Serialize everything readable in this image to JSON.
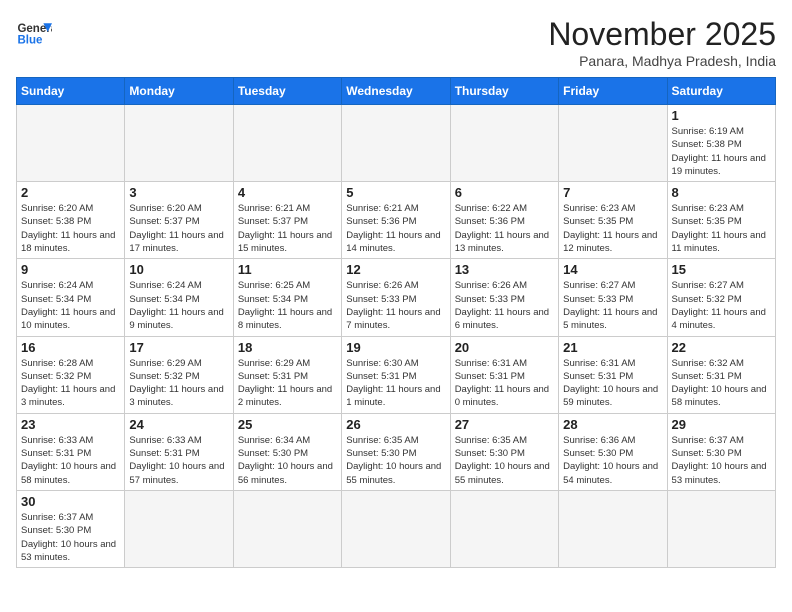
{
  "logo": {
    "text_general": "General",
    "text_blue": "Blue"
  },
  "title": "November 2025",
  "subtitle": "Panara, Madhya Pradesh, India",
  "days_of_week": [
    "Sunday",
    "Monday",
    "Tuesday",
    "Wednesday",
    "Thursday",
    "Friday",
    "Saturday"
  ],
  "weeks": [
    [
      {
        "day": "",
        "info": ""
      },
      {
        "day": "",
        "info": ""
      },
      {
        "day": "",
        "info": ""
      },
      {
        "day": "",
        "info": ""
      },
      {
        "day": "",
        "info": ""
      },
      {
        "day": "",
        "info": ""
      },
      {
        "day": "1",
        "info": "Sunrise: 6:19 AM\nSunset: 5:38 PM\nDaylight: 11 hours and 19 minutes."
      }
    ],
    [
      {
        "day": "2",
        "info": "Sunrise: 6:20 AM\nSunset: 5:38 PM\nDaylight: 11 hours and 18 minutes."
      },
      {
        "day": "3",
        "info": "Sunrise: 6:20 AM\nSunset: 5:37 PM\nDaylight: 11 hours and 17 minutes."
      },
      {
        "day": "4",
        "info": "Sunrise: 6:21 AM\nSunset: 5:37 PM\nDaylight: 11 hours and 15 minutes."
      },
      {
        "day": "5",
        "info": "Sunrise: 6:21 AM\nSunset: 5:36 PM\nDaylight: 11 hours and 14 minutes."
      },
      {
        "day": "6",
        "info": "Sunrise: 6:22 AM\nSunset: 5:36 PM\nDaylight: 11 hours and 13 minutes."
      },
      {
        "day": "7",
        "info": "Sunrise: 6:23 AM\nSunset: 5:35 PM\nDaylight: 11 hours and 12 minutes."
      },
      {
        "day": "8",
        "info": "Sunrise: 6:23 AM\nSunset: 5:35 PM\nDaylight: 11 hours and 11 minutes."
      }
    ],
    [
      {
        "day": "9",
        "info": "Sunrise: 6:24 AM\nSunset: 5:34 PM\nDaylight: 11 hours and 10 minutes."
      },
      {
        "day": "10",
        "info": "Sunrise: 6:24 AM\nSunset: 5:34 PM\nDaylight: 11 hours and 9 minutes."
      },
      {
        "day": "11",
        "info": "Sunrise: 6:25 AM\nSunset: 5:34 PM\nDaylight: 11 hours and 8 minutes."
      },
      {
        "day": "12",
        "info": "Sunrise: 6:26 AM\nSunset: 5:33 PM\nDaylight: 11 hours and 7 minutes."
      },
      {
        "day": "13",
        "info": "Sunrise: 6:26 AM\nSunset: 5:33 PM\nDaylight: 11 hours and 6 minutes."
      },
      {
        "day": "14",
        "info": "Sunrise: 6:27 AM\nSunset: 5:33 PM\nDaylight: 11 hours and 5 minutes."
      },
      {
        "day": "15",
        "info": "Sunrise: 6:27 AM\nSunset: 5:32 PM\nDaylight: 11 hours and 4 minutes."
      }
    ],
    [
      {
        "day": "16",
        "info": "Sunrise: 6:28 AM\nSunset: 5:32 PM\nDaylight: 11 hours and 3 minutes."
      },
      {
        "day": "17",
        "info": "Sunrise: 6:29 AM\nSunset: 5:32 PM\nDaylight: 11 hours and 3 minutes."
      },
      {
        "day": "18",
        "info": "Sunrise: 6:29 AM\nSunset: 5:31 PM\nDaylight: 11 hours and 2 minutes."
      },
      {
        "day": "19",
        "info": "Sunrise: 6:30 AM\nSunset: 5:31 PM\nDaylight: 11 hours and 1 minute."
      },
      {
        "day": "20",
        "info": "Sunrise: 6:31 AM\nSunset: 5:31 PM\nDaylight: 11 hours and 0 minutes."
      },
      {
        "day": "21",
        "info": "Sunrise: 6:31 AM\nSunset: 5:31 PM\nDaylight: 10 hours and 59 minutes."
      },
      {
        "day": "22",
        "info": "Sunrise: 6:32 AM\nSunset: 5:31 PM\nDaylight: 10 hours and 58 minutes."
      }
    ],
    [
      {
        "day": "23",
        "info": "Sunrise: 6:33 AM\nSunset: 5:31 PM\nDaylight: 10 hours and 58 minutes."
      },
      {
        "day": "24",
        "info": "Sunrise: 6:33 AM\nSunset: 5:31 PM\nDaylight: 10 hours and 57 minutes."
      },
      {
        "day": "25",
        "info": "Sunrise: 6:34 AM\nSunset: 5:30 PM\nDaylight: 10 hours and 56 minutes."
      },
      {
        "day": "26",
        "info": "Sunrise: 6:35 AM\nSunset: 5:30 PM\nDaylight: 10 hours and 55 minutes."
      },
      {
        "day": "27",
        "info": "Sunrise: 6:35 AM\nSunset: 5:30 PM\nDaylight: 10 hours and 55 minutes."
      },
      {
        "day": "28",
        "info": "Sunrise: 6:36 AM\nSunset: 5:30 PM\nDaylight: 10 hours and 54 minutes."
      },
      {
        "day": "29",
        "info": "Sunrise: 6:37 AM\nSunset: 5:30 PM\nDaylight: 10 hours and 53 minutes."
      }
    ],
    [
      {
        "day": "30",
        "info": "Sunrise: 6:37 AM\nSunset: 5:30 PM\nDaylight: 10 hours and 53 minutes."
      },
      {
        "day": "",
        "info": ""
      },
      {
        "day": "",
        "info": ""
      },
      {
        "day": "",
        "info": ""
      },
      {
        "day": "",
        "info": ""
      },
      {
        "day": "",
        "info": ""
      },
      {
        "day": "",
        "info": ""
      }
    ]
  ]
}
